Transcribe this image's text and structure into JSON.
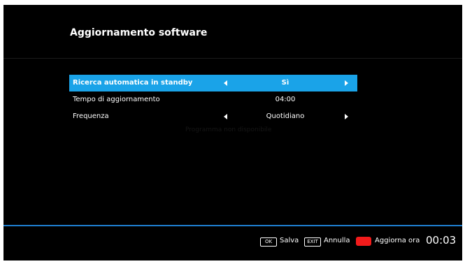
{
  "header": {
    "title": "Aggiornamento software"
  },
  "menu": {
    "items": [
      {
        "label": "Ricerca automatica in standby",
        "value": "Sì",
        "selected": true
      },
      {
        "label": "Tempo di aggiornamento",
        "value": "04:00",
        "selected": false
      },
      {
        "label": "Frequenza",
        "value": "Quotidiano",
        "selected": false
      }
    ]
  },
  "background_text": "Programma non disponibile",
  "footer": {
    "ok_key": "OK",
    "save_label": "Salva",
    "exit_key": "EXIT",
    "cancel_label": "Annulla",
    "update_label": "Aggiorna ora",
    "clock": "00:03"
  },
  "colors": {
    "accent": "#1aa3e8",
    "red_button": "#f21b1b",
    "footer_line": "#1f7fd0",
    "background": "#000000"
  }
}
